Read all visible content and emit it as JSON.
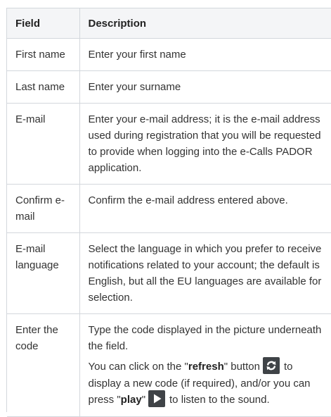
{
  "table": {
    "headers": {
      "field": "Field",
      "description": "Description"
    },
    "rows": [
      {
        "field": "First name",
        "description": "Enter your first name"
      },
      {
        "field": "Last name",
        "description": "Enter your surname"
      },
      {
        "field": "E-mail",
        "description": "Enter your e-mail address; it is the e-mail address used during registration that you will be requested to provide when logging into the e-Calls PADOR application."
      },
      {
        "field": "Confirm e-mail",
        "description": "Confirm the e-mail address entered above."
      },
      {
        "field": "E-mail language",
        "description": "Select the language in which you prefer to receive notifications related to your account; the default is English, but all the EU languages are available for selection."
      },
      {
        "field": "Enter the code",
        "description_p1": "Type the code displayed in the picture underneath the field.",
        "description_p2": {
          "pre": "You can click on the \"",
          "refresh": "refresh",
          "mid1": "\" button",
          "mid2": "to display a new code (if required), and/or you can press \"",
          "play": "play",
          "mid3": "\"",
          "post": "to listen to the sound."
        }
      }
    ]
  },
  "icons": {
    "refresh": "refresh-icon",
    "play": "play-icon",
    "icon_bg": "#3f4347",
    "icon_fg": "#ffffff"
  },
  "colors": {
    "header_bg": "#f4f5f7",
    "border": "#d3d7dc",
    "text": "#333333"
  }
}
